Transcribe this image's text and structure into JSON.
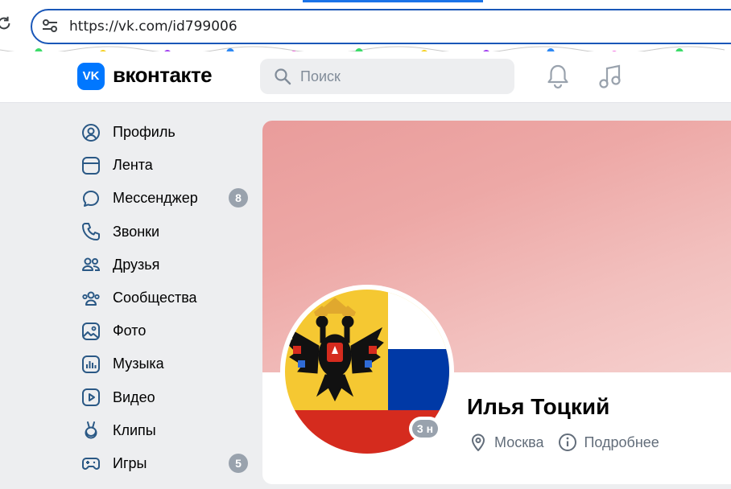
{
  "browser": {
    "url": "https://vk.com/id799006"
  },
  "header": {
    "logo_mark": "VK",
    "wordmark": "вконтакте",
    "search_placeholder": "Поиск"
  },
  "sidebar": {
    "items": [
      {
        "label": "Профиль",
        "icon": "profile-icon",
        "badge": ""
      },
      {
        "label": "Лента",
        "icon": "feed-icon",
        "badge": ""
      },
      {
        "label": "Мессенджер",
        "icon": "messenger-icon",
        "badge": "8"
      },
      {
        "label": "Звонки",
        "icon": "phone-icon",
        "badge": ""
      },
      {
        "label": "Друзья",
        "icon": "friends-icon",
        "badge": ""
      },
      {
        "label": "Сообщества",
        "icon": "communities-icon",
        "badge": ""
      },
      {
        "label": "Фото",
        "icon": "photo-icon",
        "badge": ""
      },
      {
        "label": "Музыка",
        "icon": "music-icon",
        "badge": ""
      },
      {
        "label": "Видео",
        "icon": "video-icon",
        "badge": ""
      },
      {
        "label": "Клипы",
        "icon": "clips-icon",
        "badge": ""
      },
      {
        "label": "Игры",
        "icon": "games-icon",
        "badge": "5"
      }
    ]
  },
  "profile": {
    "name": "Илья Тоцкий",
    "last_seen": "3 н",
    "city": "Москва",
    "details_link": "Подробнее"
  },
  "colors": {
    "accent": "#0077ff",
    "icon": "#2a5885",
    "badge": "#99a2ad"
  }
}
